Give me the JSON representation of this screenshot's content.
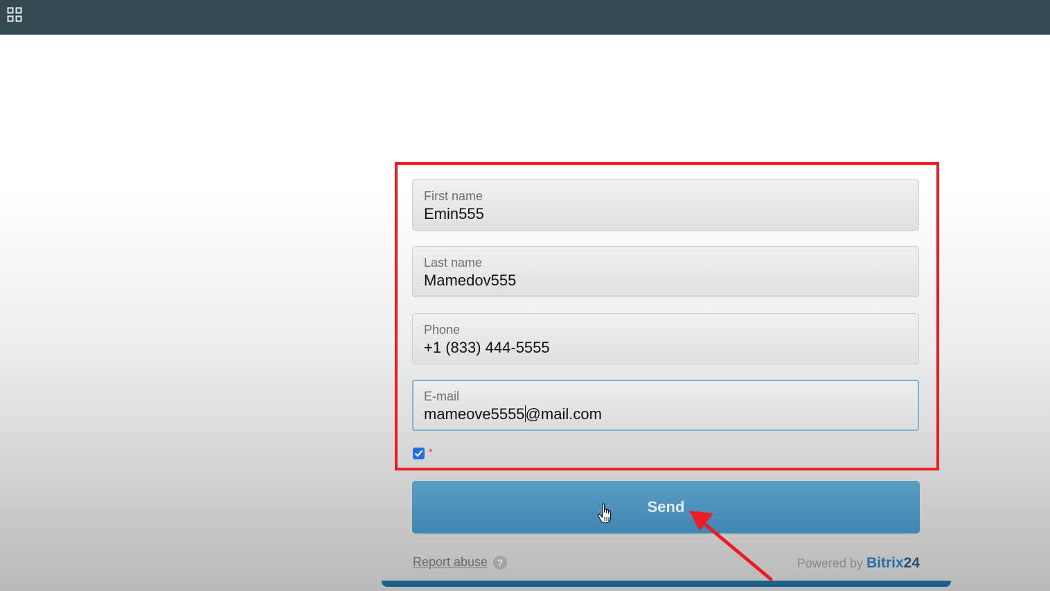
{
  "app": {
    "menu_icon": "grid-icon"
  },
  "form": {
    "fields": [
      {
        "label": "First name",
        "value": "Emin555"
      },
      {
        "label": "Last name",
        "value": "Mamedov555"
      },
      {
        "label": "Phone",
        "value": "+1 (833) 444-5555"
      },
      {
        "label": "E-mail",
        "value_before_caret": "mameove5555",
        "value_after_caret": "@mail.com"
      }
    ],
    "consent_checked": true,
    "required_mark": "*",
    "submit_label": "Send"
  },
  "footer": {
    "report_abuse": "Report abuse",
    "help_icon": "question-mark-icon",
    "help_glyph": "?",
    "powered_by": "Powered by",
    "brand_name": "Bitrix",
    "brand_number": "24"
  },
  "colors": {
    "topbar": "#344a51",
    "highlight": "#ee1d23",
    "button": "#4a90bb",
    "brand": "#2a6da3"
  }
}
